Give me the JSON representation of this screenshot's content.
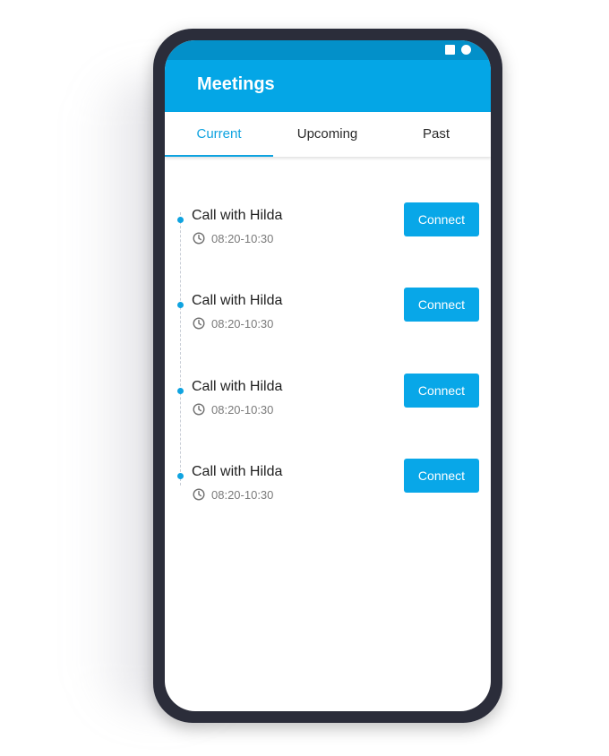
{
  "app": {
    "title": "Meetings"
  },
  "colors": {
    "primary": "#04a6e6",
    "status_bar": "#0390c9",
    "accent": "#0fa3e0",
    "frame": "#2b2d3a"
  },
  "tabs": [
    {
      "label": "Current",
      "active": true
    },
    {
      "label": "Upcoming",
      "active": false
    },
    {
      "label": "Past",
      "active": false
    }
  ],
  "meetings": [
    {
      "title": "Call with Hilda",
      "time": "08:20-10:30",
      "action_label": "Connect"
    },
    {
      "title": "Call with Hilda",
      "time": "08:20-10:30",
      "action_label": "Connect"
    },
    {
      "title": "Call with Hilda",
      "time": "08:20-10:30",
      "action_label": "Connect"
    },
    {
      "title": "Call with Hilda",
      "time": "08:20-10:30",
      "action_label": "Connect"
    }
  ],
  "icons": {
    "status_square": "square-icon",
    "status_circle": "circle-icon",
    "time": "clock-icon"
  }
}
